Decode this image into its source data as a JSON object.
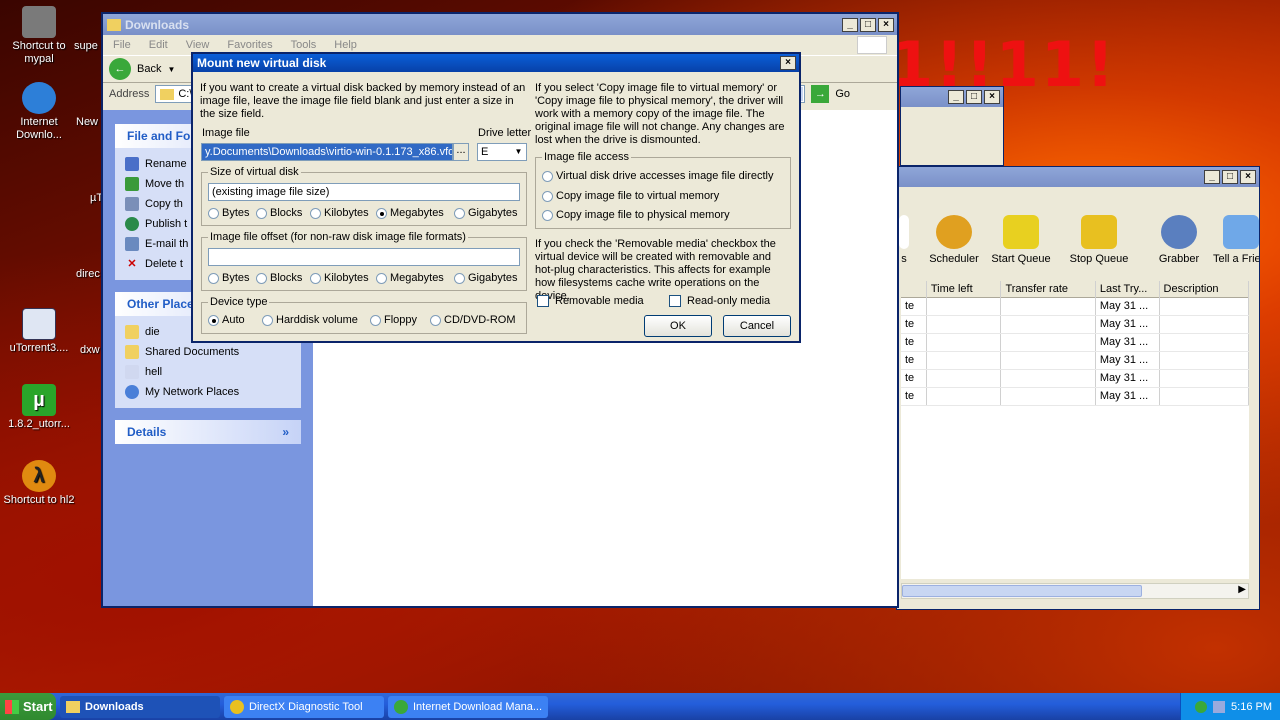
{
  "desktop": {
    "banner_text": "1!!11!",
    "icons": [
      {
        "label": "Shortcut to mypal",
        "color": "#7a7a7a"
      },
      {
        "label": "Internet Downlo...",
        "color": "#2d7fd8"
      },
      {
        "label": "uTorrent3....",
        "color": "#dfe6f3"
      },
      {
        "label": "1.8.2_utorr...",
        "color": "#2aa52a"
      },
      {
        "label": "Shortcut to hl2",
        "color": "#e08a10"
      }
    ],
    "partial_labels": [
      "supe",
      "New",
      "µT",
      "direc",
      "dxw"
    ]
  },
  "explorer": {
    "title": "Downloads",
    "menu": [
      "File",
      "Edit",
      "View",
      "Favorites",
      "Tools",
      "Help"
    ],
    "back_label": "Back",
    "address_label": "Address",
    "address_value": "C:\\",
    "go_label": "Go",
    "file_folder_panel": {
      "title": "File and Fol",
      "items": [
        "Rename",
        "Move th",
        "Copy th",
        "Publish t",
        "E-mail th",
        "Delete t"
      ]
    },
    "other_places": {
      "title": "Other Place",
      "items": [
        "die",
        "Shared Documents",
        "hell",
        "My Network Places"
      ]
    },
    "details_title": "Details"
  },
  "dialog": {
    "title": "Mount new virtual disk",
    "intro": "If you want to create a virtual disk backed by memory instead of an image file, leave the image file field blank and just enter a size in the size field.",
    "image_file_label": "Image file",
    "image_file_value": "y.Documents\\Downloads\\virtio-win-0.1.173_x86.vfd",
    "browse_label": "...",
    "drive_letter_label": "Drive letter",
    "drive_letter_value": "E",
    "size_legend": "Size of virtual disk",
    "size_value": "(existing image file size)",
    "size_units": [
      "Bytes",
      "Blocks",
      "Kilobytes",
      "Megabytes",
      "Gigabytes"
    ],
    "size_unit_selected": "Megabytes",
    "offset_legend": "Image file offset (for non-raw disk image file formats)",
    "offset_value": "",
    "offset_units": [
      "Bytes",
      "Blocks",
      "Kilobytes",
      "Megabytes",
      "Gigabytes"
    ],
    "device_type_legend": "Device type",
    "device_types": [
      "Auto",
      "Harddisk volume",
      "Floppy",
      "CD/DVD-ROM"
    ],
    "device_type_selected": "Auto",
    "copy_note": "If you select 'Copy image file to virtual memory' or 'Copy image file to physical memory', the driver will work with a memory copy of the image file. The original image file will not change. Any changes are lost when the drive is dismounted.",
    "access_legend": "Image file access",
    "access_options": [
      "Virtual disk drive accesses image file directly",
      "Copy image file to virtual memory",
      "Copy image file to physical memory"
    ],
    "removable_note": "If you check the 'Removable media' checkbox the virtual device will be created with removable and hot-plug characteristics. This affects for example how filesystems cache write operations on the device.",
    "removable_label": "Removable media",
    "readonly_label": "Read-only media",
    "ok_label": "OK",
    "cancel_label": "Cancel"
  },
  "idm": {
    "toolbar": [
      {
        "label": "s",
        "color": "#ffffff"
      },
      {
        "label": "Scheduler",
        "color": "#e0a020"
      },
      {
        "label": "Start Queue",
        "color": "#e8d020"
      },
      {
        "label": "Stop Queue",
        "color": "#e8c020"
      },
      {
        "label": "Grabber",
        "color": "#5a7fbf"
      },
      {
        "label": "Tell a Frie",
        "color": "#6fa8e8"
      }
    ],
    "columns": [
      "",
      "Time left",
      "Transfer rate",
      "Last Try...",
      "Description"
    ],
    "rows": [
      [
        "te",
        "",
        "",
        "May 31 ...",
        ""
      ],
      [
        "te",
        "",
        "",
        "May 31 ...",
        ""
      ],
      [
        "te",
        "",
        "",
        "May 31 ...",
        ""
      ],
      [
        "te",
        "",
        "",
        "May 31 ...",
        ""
      ],
      [
        "te",
        "",
        "",
        "May 31 ...",
        ""
      ],
      [
        "te",
        "",
        "",
        "May 31 ...",
        ""
      ]
    ]
  },
  "taskbar": {
    "start_label": "Start",
    "tasks": [
      "Downloads",
      "DirectX Diagnostic Tool",
      "Internet Download Mana..."
    ],
    "clock": "5:16 PM"
  }
}
